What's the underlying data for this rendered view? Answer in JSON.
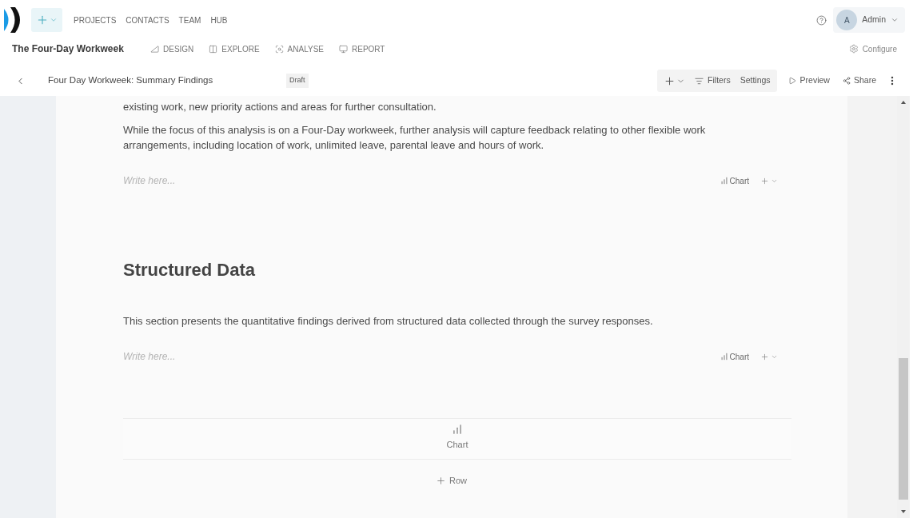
{
  "top_nav": {
    "items": [
      "PROJECTS",
      "CONTACTS",
      "TEAM",
      "HUB"
    ],
    "user": {
      "initial": "A",
      "name": "Admin"
    }
  },
  "project_bar": {
    "title": "The Four-Day Workweek",
    "tabs": [
      {
        "kind": "design",
        "label": "DESIGN"
      },
      {
        "kind": "explore",
        "label": "EXPLORE"
      },
      {
        "kind": "analyse",
        "label": "ANALYSE"
      },
      {
        "kind": "report",
        "label": "REPORT"
      }
    ],
    "configure": "Configure"
  },
  "report_bar": {
    "title": "Four Day Workweek: Summary Findings",
    "status": "Draft",
    "tools": [
      {
        "kind": "add"
      },
      {
        "kind": "filters",
        "label": "Filters"
      },
      {
        "kind": "settings",
        "label": "Settings"
      }
    ],
    "actions": [
      {
        "kind": "preview",
        "label": "Preview"
      },
      {
        "kind": "share",
        "label": "Share"
      },
      {
        "kind": "more"
      }
    ]
  },
  "document": {
    "sections": [
      {
        "paragraphs": [
          "existing work, new priority actions and areas for further consultation.",
          "While the focus of this analysis is on a Four-Day workweek, further analysis will capture feedback relating to other flexible work arrangements, including location of work, unlimited leave, parental leave and hours of work."
        ],
        "editor": {
          "placeholder": "Write here...",
          "chart_button": "Chart"
        }
      },
      {
        "heading": "Structured Data",
        "paragraphs": [
          "This section presents the quantitative findings derived from structured data collected through the survey responses."
        ],
        "editor": {
          "placeholder": "Write here...",
          "chart_button": "Chart"
        }
      }
    ],
    "chart_block": {
      "label": "Chart"
    },
    "add_row": {
      "label": "Row"
    }
  }
}
